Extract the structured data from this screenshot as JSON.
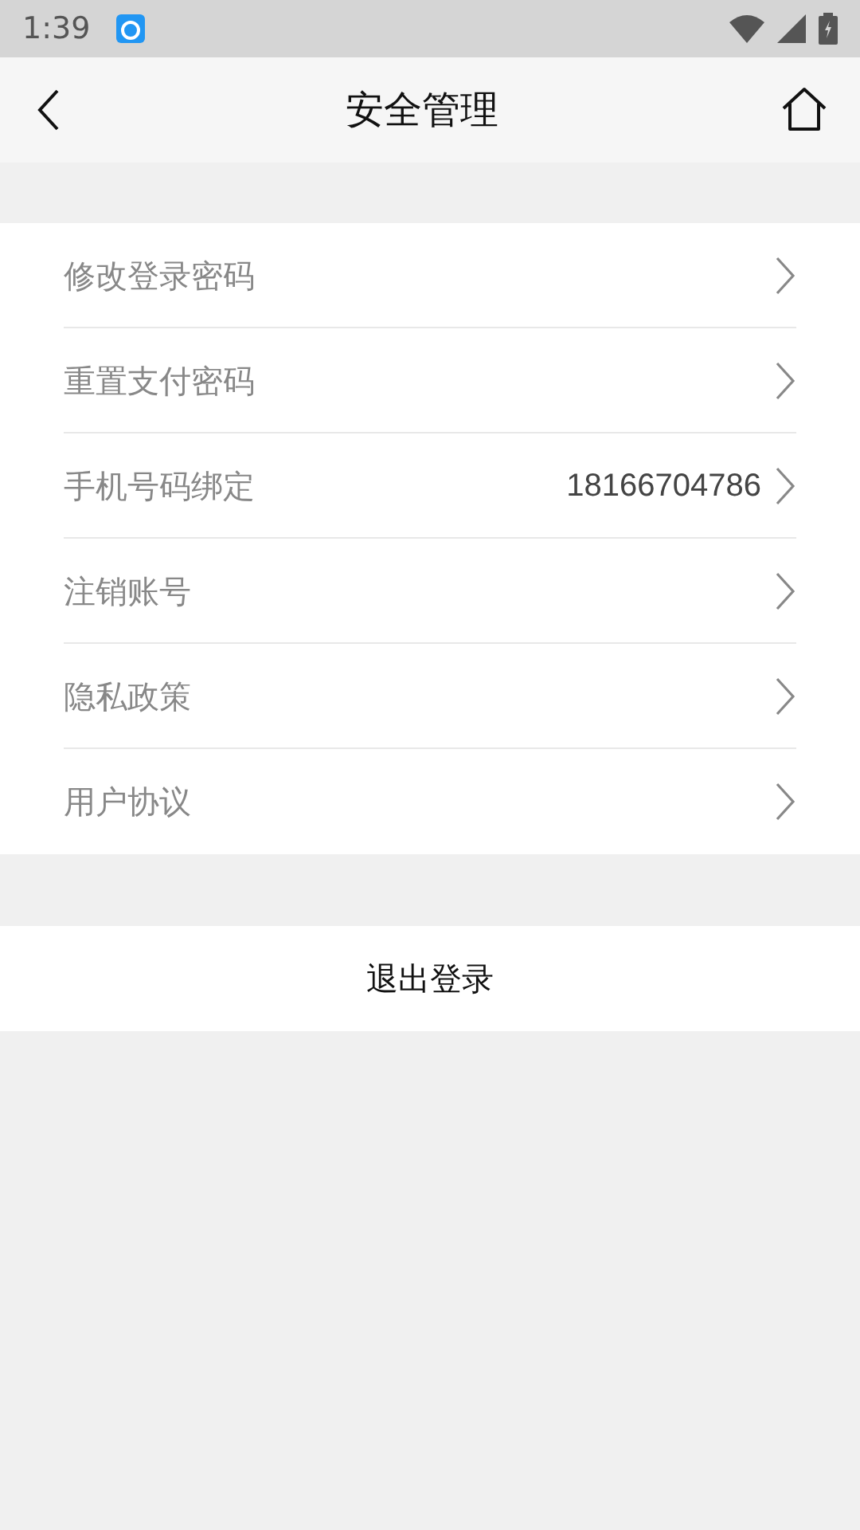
{
  "status_bar": {
    "time": "1:39"
  },
  "header": {
    "title": "安全管理"
  },
  "menu_items": [
    {
      "label": "修改登录密码"
    },
    {
      "label": "重置支付密码"
    },
    {
      "label": "手机号码绑定",
      "value": "18166704786"
    },
    {
      "label": "注销账号"
    },
    {
      "label": "隐私政策"
    },
    {
      "label": "用户协议"
    }
  ],
  "logout_button": {
    "label": "退出登录"
  }
}
